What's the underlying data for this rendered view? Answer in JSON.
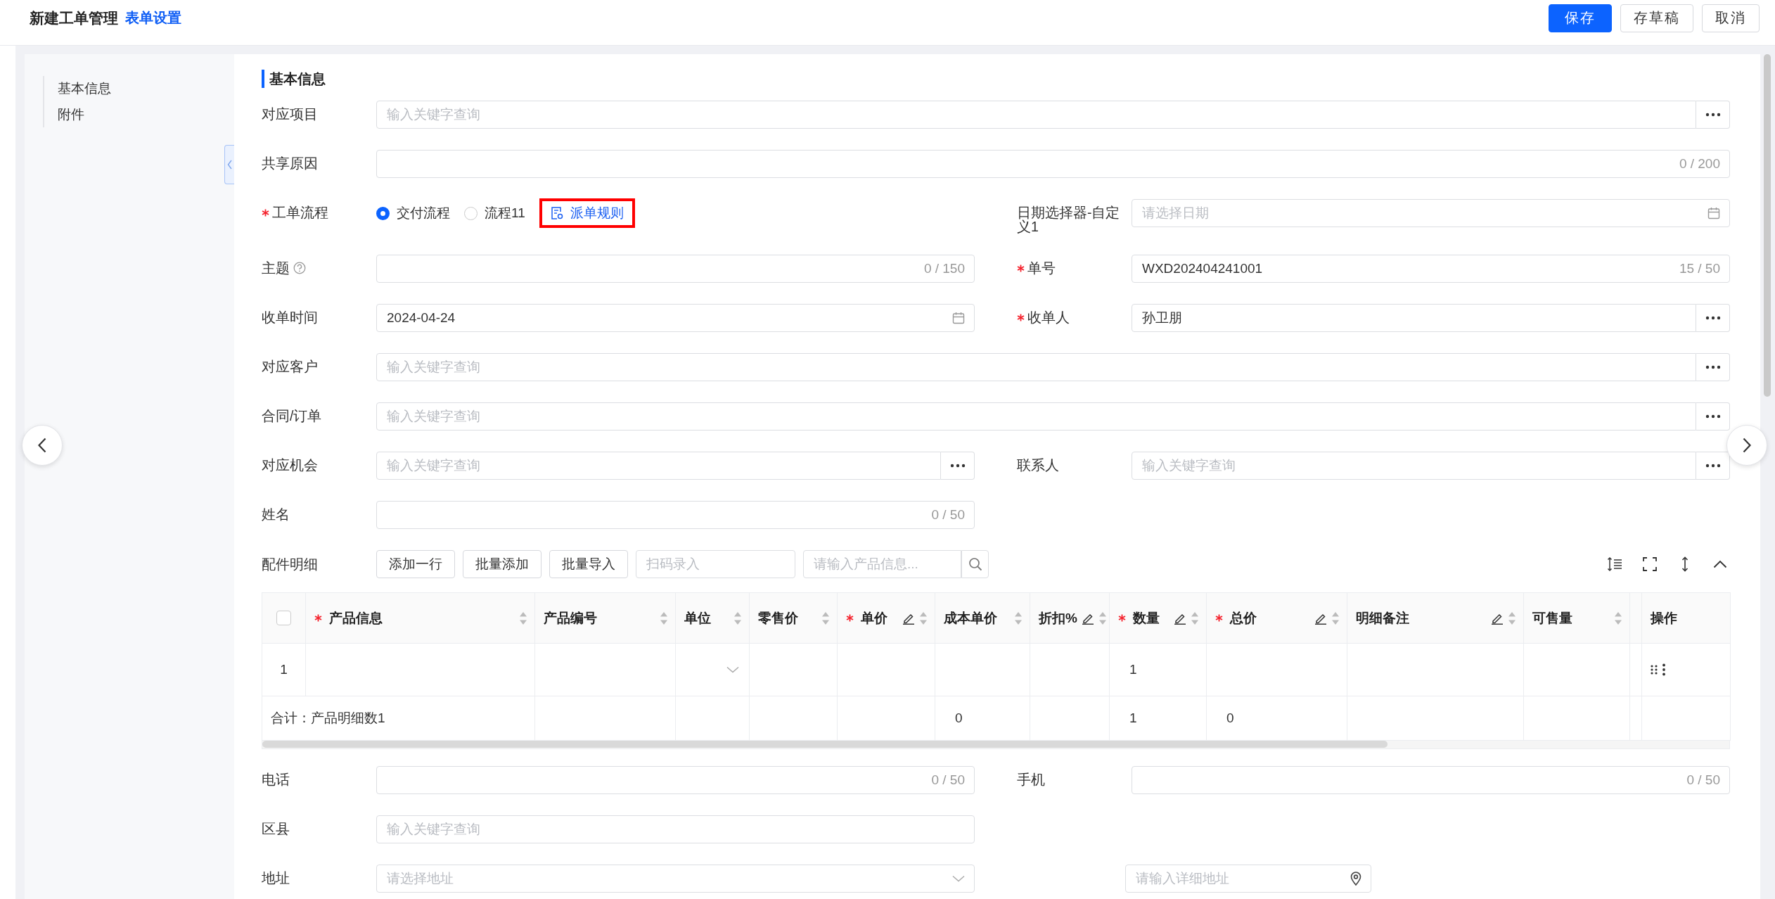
{
  "header": {
    "title": "新建工单管理",
    "link": "表单设置",
    "buttons": [
      {
        "label": "保存",
        "kind": "primary"
      },
      {
        "label": "存草稿",
        "kind": "default"
      },
      {
        "label": "取消",
        "kind": "default"
      }
    ]
  },
  "nav": {
    "items": [
      {
        "label": "基本信息"
      },
      {
        "label": "附件"
      }
    ]
  },
  "form": {
    "section_title": "基本信息",
    "rows": [
      {
        "kind": "fields",
        "fields": [
          {
            "kind": "lookup",
            "label": "对应项目",
            "required": false,
            "wide": true,
            "placeholder": "输入关键字查询"
          }
        ]
      },
      {
        "kind": "fields",
        "fields": [
          {
            "kind": "text",
            "label": "共享原因",
            "required": false,
            "wide": true,
            "counter": "0 / 200"
          }
        ]
      },
      {
        "kind": "fields",
        "fields": [
          {
            "kind": "radio",
            "label": "工单流程",
            "required": true,
            "wide": false,
            "options": [
              {
                "label": "交付流程",
                "selected": true
              },
              {
                "label": "流程11",
                "selected": false
              }
            ],
            "link": {
              "label": "派单规则",
              "highlighted": true
            }
          },
          {
            "kind": "date",
            "label": "日期选择器-自定义1",
            "required": false,
            "wide": false,
            "placeholder": "请选择日期"
          }
        ]
      },
      {
        "kind": "fields",
        "fields": [
          {
            "kind": "text",
            "label": "主题",
            "help": true,
            "required": false,
            "wide": false,
            "counter": "0 / 150"
          },
          {
            "kind": "text",
            "label": "单号",
            "required": true,
            "wide": false,
            "value": "WXD202404241001",
            "counter": "15 / 50"
          }
        ]
      },
      {
        "kind": "fields",
        "fields": [
          {
            "kind": "date",
            "label": "收单时间",
            "required": false,
            "wide": false,
            "value": "2024-04-24"
          },
          {
            "kind": "lookup",
            "label": "收单人",
            "required": true,
            "wide": false,
            "value": "孙卫朋"
          }
        ]
      },
      {
        "kind": "fields",
        "fields": [
          {
            "kind": "lookup",
            "label": "对应客户",
            "required": false,
            "wide": true,
            "placeholder": "输入关键字查询"
          }
        ]
      },
      {
        "kind": "fields",
        "fields": [
          {
            "kind": "lookup",
            "label": "合同/订单",
            "required": false,
            "wide": true,
            "placeholder": "输入关键字查询"
          }
        ]
      },
      {
        "kind": "fields",
        "fields": [
          {
            "kind": "lookup",
            "label": "对应机会",
            "required": false,
            "wide": false,
            "placeholder": "输入关键字查询"
          },
          {
            "kind": "lookup",
            "label": "联系人",
            "required": false,
            "wide": false,
            "placeholder": "输入关键字查询"
          }
        ]
      },
      {
        "kind": "fields",
        "fields": [
          {
            "kind": "text",
            "label": "姓名",
            "required": false,
            "wide": false,
            "counter": "0 / 50"
          }
        ]
      },
      {
        "kind": "parts",
        "label": "配件明细",
        "buttons": [
          "添加一行",
          "批量添加",
          "批量导入"
        ],
        "scan_placeholder": "扫码录入",
        "search_placeholder": "请输入产品信息...",
        "table": {
          "select_all": {
            "checked": false
          },
          "columns": [
            {
              "label": "产品信息",
              "required": true,
              "editable": false,
              "sortable": true
            },
            {
              "label": "产品编号",
              "required": false,
              "editable": false,
              "sortable": true
            },
            {
              "label": "单位",
              "required": false,
              "editable": false,
              "sortable": true
            },
            {
              "label": "零售价",
              "required": false,
              "editable": false,
              "sortable": true
            },
            {
              "label": "单价",
              "required": true,
              "editable": true,
              "sortable": true
            },
            {
              "label": "成本单价",
              "required": false,
              "editable": false,
              "sortable": true
            },
            {
              "label": "折扣%",
              "required": false,
              "editable": true,
              "sortable": true
            },
            {
              "label": "数量",
              "required": true,
              "editable": true,
              "sortable": true
            },
            {
              "label": "总价",
              "required": true,
              "editable": true,
              "sortable": true
            },
            {
              "label": "明细备注",
              "required": false,
              "editable": true,
              "sortable": true
            },
            {
              "label": "可售量",
              "required": false,
              "editable": false,
              "sortable": true
            },
            {
              "label": "操作",
              "required": false,
              "editable": false,
              "sortable": false
            }
          ],
          "rows": [
            {
              "kind": "item",
              "number": "1",
              "cells": [
                null,
                null,
                {
                  "kind": "select"
                },
                null,
                null,
                null,
                null,
                {
                  "kind": "text",
                  "text": "1"
                },
                null,
                null,
                null,
                {
                  "kind": "actions"
                }
              ]
            },
            {
              "kind": "summary",
              "label": "合计：产品明细数1",
              "cells": [
                null,
                null,
                null,
                null,
                null,
                {
                  "kind": "text",
                  "text": "0"
                },
                null,
                {
                  "kind": "text",
                  "text": "1"
                },
                {
                  "kind": "text",
                  "text": "0"
                },
                null,
                null,
                null
              ]
            }
          ]
        }
      },
      {
        "kind": "fields",
        "fields": [
          {
            "kind": "text",
            "label": "电话",
            "required": false,
            "wide": false,
            "counter": "0 / 50"
          },
          {
            "kind": "text",
            "label": "手机",
            "required": false,
            "wide": false,
            "counter": "0 / 50"
          }
        ]
      },
      {
        "kind": "fields",
        "fields": [
          {
            "kind": "input",
            "label": "区县",
            "required": false,
            "wide": false,
            "placeholder": "输入关键字查询"
          }
        ]
      },
      {
        "kind": "fields",
        "fields": [
          {
            "kind": "select",
            "label": "地址",
            "required": false,
            "wide": false,
            "placeholder": "请选择地址"
          },
          {
            "kind": "location",
            "required": false,
            "wide": false,
            "placeholder": "请输入详细地址"
          }
        ]
      }
    ]
  }
}
